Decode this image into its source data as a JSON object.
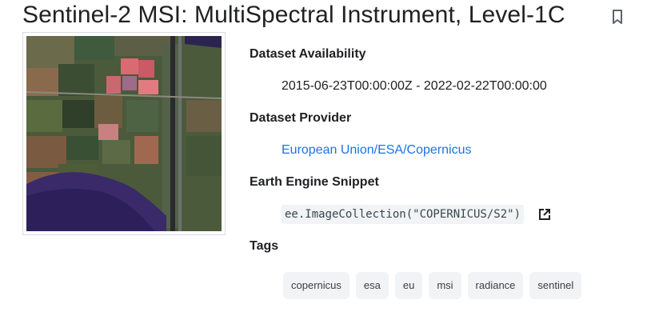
{
  "page": {
    "title": "Sentinel-2 MSI: MultiSpectral Instrument, Level-1C",
    "bookmark_icon": "bookmark-icon"
  },
  "details": {
    "availability_label": "Dataset Availability",
    "availability_value": "2015-06-23T00:00:00Z - 2022-02-22T00:00:00",
    "provider_label": "Dataset Provider",
    "provider_value": "European Union/ESA/Copernicus",
    "snippet_label": "Earth Engine Snippet",
    "snippet_value": "ee.ImageCollection(\"COPERNICUS/S2\")",
    "snippet_icon": "open-in-new-icon",
    "tags_label": "Tags",
    "tags": [
      "copernicus",
      "esa",
      "eu",
      "msi",
      "radiance",
      "sentinel"
    ]
  },
  "colors": {
    "link": "#1a73e8",
    "chip_bg": "#f1f3f4",
    "text": "#202124"
  }
}
